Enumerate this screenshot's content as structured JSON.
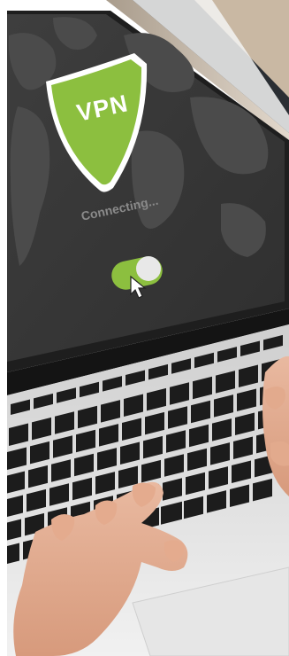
{
  "photo": {
    "subject": "hands-typing-on-laptop-with-vpn-screen",
    "screen": {
      "shield_label": "VPN",
      "status_text": "Connecting...",
      "toggle_state": "on"
    },
    "colors": {
      "shield_green": "#8cbf3f",
      "screen_bg": "#3b3b3b",
      "map_land": "#4e4e4e",
      "key_black": "#1c1c1c",
      "keyboard_deck": "#dcdcdc",
      "skin": "#e7b59a",
      "toggle_knob": "#e8e8e8"
    },
    "icons": [
      "shield-icon",
      "cursor-icon",
      "toggle-switch"
    ]
  }
}
